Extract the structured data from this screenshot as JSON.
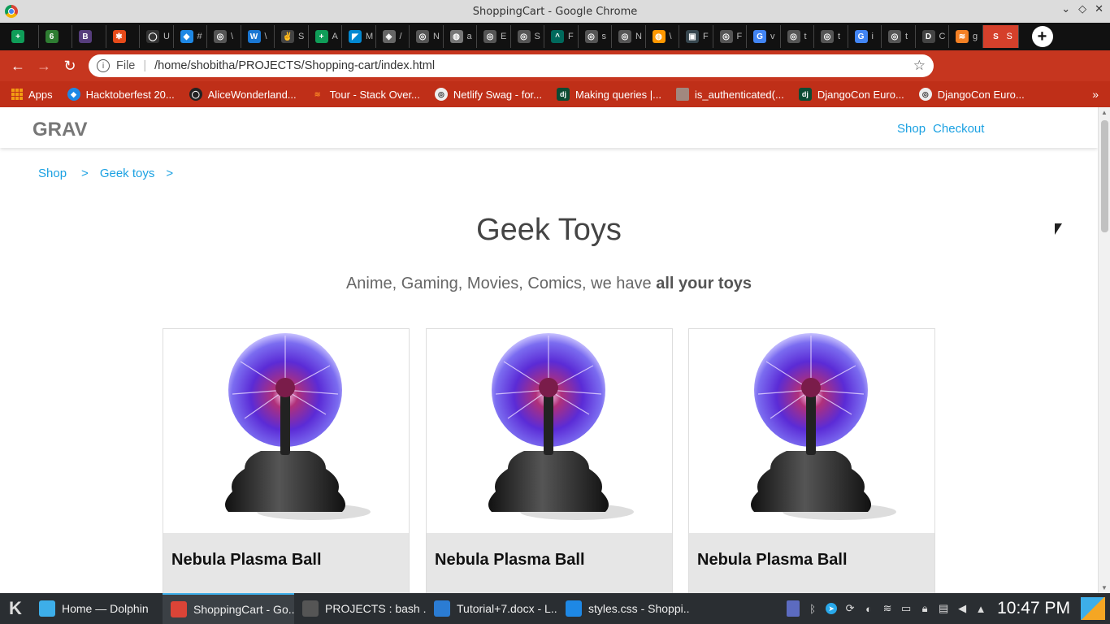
{
  "window": {
    "title": "ShoppingCart - Google Chrome"
  },
  "tabs": [
    {
      "letter": "+",
      "color": "#0f9d58",
      "text": ""
    },
    {
      "letter": "6",
      "color": "#2e7d32",
      "text": ""
    },
    {
      "letter": "B",
      "color": "#563d7c",
      "text": ""
    },
    {
      "letter": "✱",
      "color": "#e64a19",
      "text": ""
    },
    {
      "letter": "◯",
      "color": "#333333",
      "text": "U"
    },
    {
      "letter": "◆",
      "color": "#1e88e5",
      "text": "#"
    },
    {
      "letter": "◎",
      "color": "#555555",
      "text": "\\"
    },
    {
      "letter": "W",
      "color": "#1976d2",
      "text": "\\"
    },
    {
      "letter": "✌",
      "color": "#444444",
      "text": "S"
    },
    {
      "letter": "+",
      "color": "#0f9d58",
      "text": "A"
    },
    {
      "letter": "◤",
      "color": "#0288d1",
      "text": "M"
    },
    {
      "letter": "◈",
      "color": "#666666",
      "text": "/"
    },
    {
      "letter": "◎",
      "color": "#555555",
      "text": "N"
    },
    {
      "letter": "◍",
      "color": "#777777",
      "text": "a"
    },
    {
      "letter": "◎",
      "color": "#555555",
      "text": "E"
    },
    {
      "letter": "◎",
      "color": "#555555",
      "text": "S"
    },
    {
      "letter": "^",
      "color": "#00695c",
      "text": "F"
    },
    {
      "letter": "◎",
      "color": "#555555",
      "text": "s"
    },
    {
      "letter": "◎",
      "color": "#555555",
      "text": "N"
    },
    {
      "letter": "◍",
      "color": "#ff9800",
      "text": "\\"
    },
    {
      "letter": "▣",
      "color": "#37474f",
      "text": "F"
    },
    {
      "letter": "◎",
      "color": "#555555",
      "text": "F"
    },
    {
      "letter": "G",
      "color": "#4285f4",
      "text": "v"
    },
    {
      "letter": "◎",
      "color": "#555555",
      "text": "t"
    },
    {
      "letter": "◎",
      "color": "#555555",
      "text": "t"
    },
    {
      "letter": "G",
      "color": "#4285f4",
      "text": "i"
    },
    {
      "letter": "◎",
      "color": "#555555",
      "text": "t"
    },
    {
      "letter": "D",
      "color": "#444444",
      "text": "C"
    },
    {
      "letter": "≋",
      "color": "#f48024",
      "text": "g"
    },
    {
      "letter": "S",
      "color": "#d5402b",
      "text": "S",
      "active": true
    }
  ],
  "toolbar": {
    "back": "←",
    "forward": "→",
    "reload": "↻",
    "file_label": "File",
    "url": "/home/shobitha/PROJECTS/Shopping-cart/index.html"
  },
  "bookmarks": {
    "items": [
      {
        "label": "Apps",
        "icon": "apps-grid-icon"
      },
      {
        "label": "Hacktoberfest 20...",
        "icon": "hacktoberfest-icon"
      },
      {
        "label": "AliceWonderland...",
        "icon": "github-icon"
      },
      {
        "label": "Tour - Stack Over...",
        "icon": "stackoverflow-icon"
      },
      {
        "label": "Netlify Swag - for...",
        "icon": "globe-icon"
      },
      {
        "label": "Making queries |...",
        "icon": "django-icon"
      },
      {
        "label": "is_authenticated(...",
        "icon": "avatar-icon"
      },
      {
        "label": "DjangoCon Euro...",
        "icon": "django-icon"
      },
      {
        "label": "DjangoCon Euro...",
        "icon": "globe-icon"
      }
    ],
    "more": "»"
  },
  "site": {
    "brand": "GRAV",
    "nav": [
      "Shop",
      "Checkout"
    ],
    "breadcrumbs": [
      "Shop",
      ">",
      "Geek toys",
      ">"
    ],
    "heading": "Geek Toys",
    "subtitle_plain": "Anime, Gaming, Movies, Comics, we have ",
    "subtitle_bold": "all your toys",
    "products": [
      {
        "name": "Nebula Plasma Ball"
      },
      {
        "name": "Nebula Plasma Ball"
      },
      {
        "name": "Nebula Plasma Ball"
      }
    ]
  },
  "taskbar": {
    "tasks": [
      {
        "label": "Home — Dolphin",
        "color": "#3daee9"
      },
      {
        "label": "ShoppingCart - Go...",
        "color": "#db4437",
        "active": true
      },
      {
        "label": "PROJECTS : bash ...",
        "color": "#555555"
      },
      {
        "label": "Tutorial+7.docx - L...",
        "color": "#2b7cd3"
      },
      {
        "label": "styles.css - Shoppi...",
        "color": "#1e88e5"
      }
    ],
    "clock": "10:47 PM"
  }
}
